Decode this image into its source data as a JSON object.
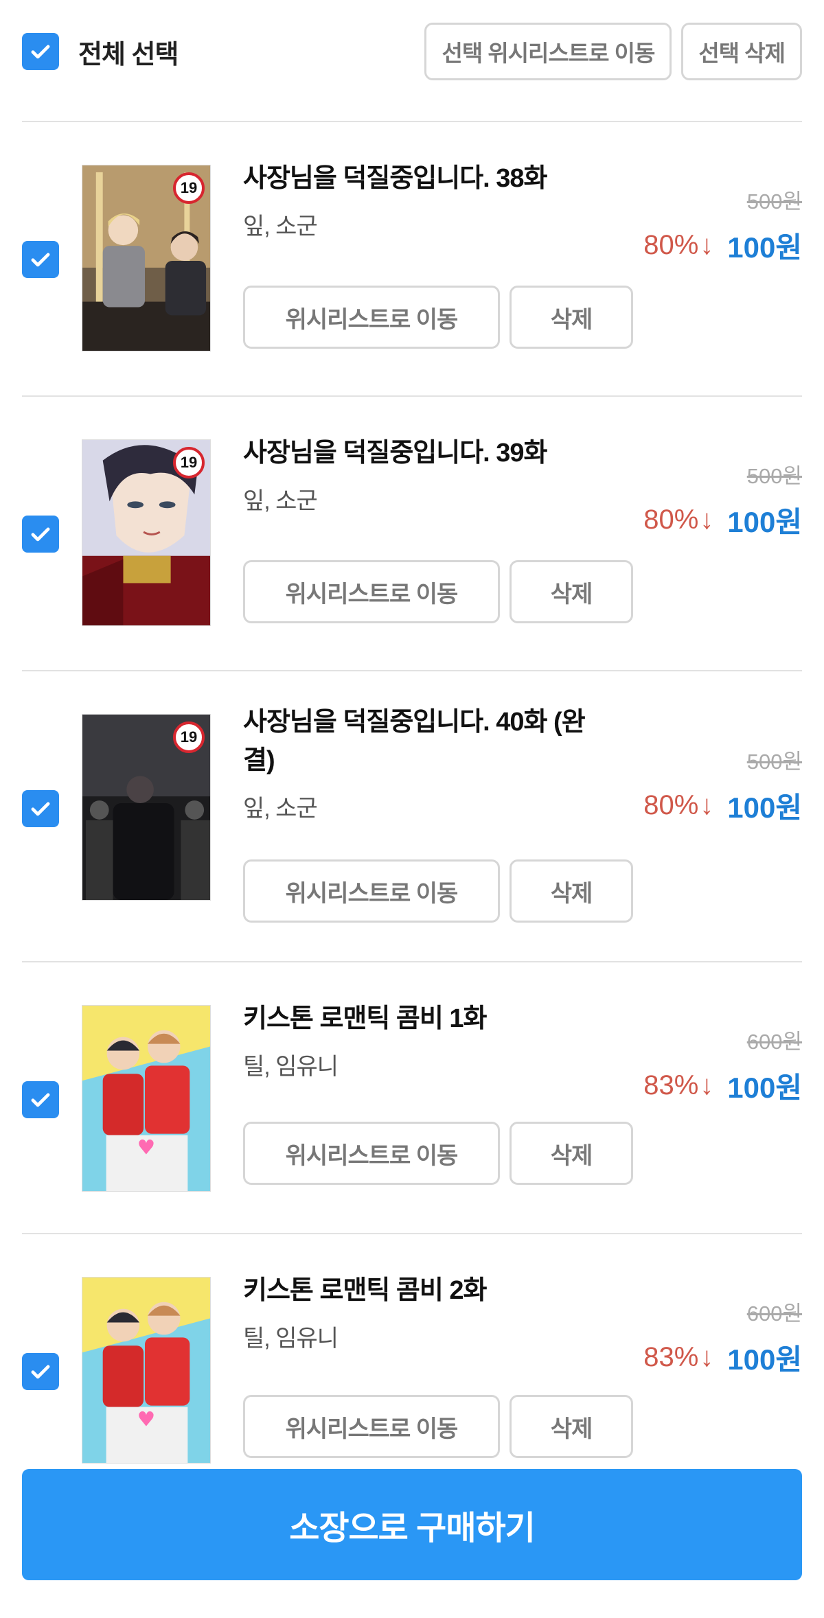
{
  "header": {
    "select_all_label": "전체 선택",
    "move_selected_label": "선택 위시리스트로 이동",
    "delete_selected_label": "선택 삭제"
  },
  "items": [
    {
      "title": "사장님을 덕질중입니다. 38화",
      "author": "잎, 소군",
      "original_price": "500원",
      "discount": "80%",
      "price": "100원",
      "age_badge": "19",
      "checked": true,
      "wishlist_label": "위시리스트로 이동",
      "delete_label": "삭제"
    },
    {
      "title": "사장님을 덕질중입니다. 39화",
      "author": "잎, 소군",
      "original_price": "500원",
      "discount": "80%",
      "price": "100원",
      "age_badge": "19",
      "checked": true,
      "wishlist_label": "위시리스트로 이동",
      "delete_label": "삭제"
    },
    {
      "title_line1": "사장님을 덕질중입니다. 40화 (완",
      "title_line2": "결)",
      "author": "잎, 소군",
      "original_price": "500원",
      "discount": "80%",
      "price": "100원",
      "age_badge": "19",
      "checked": true,
      "wishlist_label": "위시리스트로 이동",
      "delete_label": "삭제"
    },
    {
      "title": "키스톤 로맨틱 콤비 1화",
      "author": "틸, 임유니",
      "original_price": "600원",
      "discount": "83%",
      "price": "100원",
      "checked": true,
      "wishlist_label": "위시리스트로 이동",
      "delete_label": "삭제"
    },
    {
      "title": "키스톤 로맨틱 콤비 2화",
      "author": "틸, 임유니",
      "original_price": "600원",
      "discount": "83%",
      "price": "100원",
      "checked": true,
      "wishlist_label": "위시리스트로 이동",
      "delete_label": "삭제"
    }
  ],
  "footer": {
    "buy_label": "소장으로 구매하기"
  },
  "icons": {
    "checkbox": "checkmark-icon",
    "discount_arrow": "arrow-down-icon"
  },
  "colors": {
    "accent": "#2a97f5",
    "price": "#1e7fd6",
    "discount": "#d0584a"
  }
}
